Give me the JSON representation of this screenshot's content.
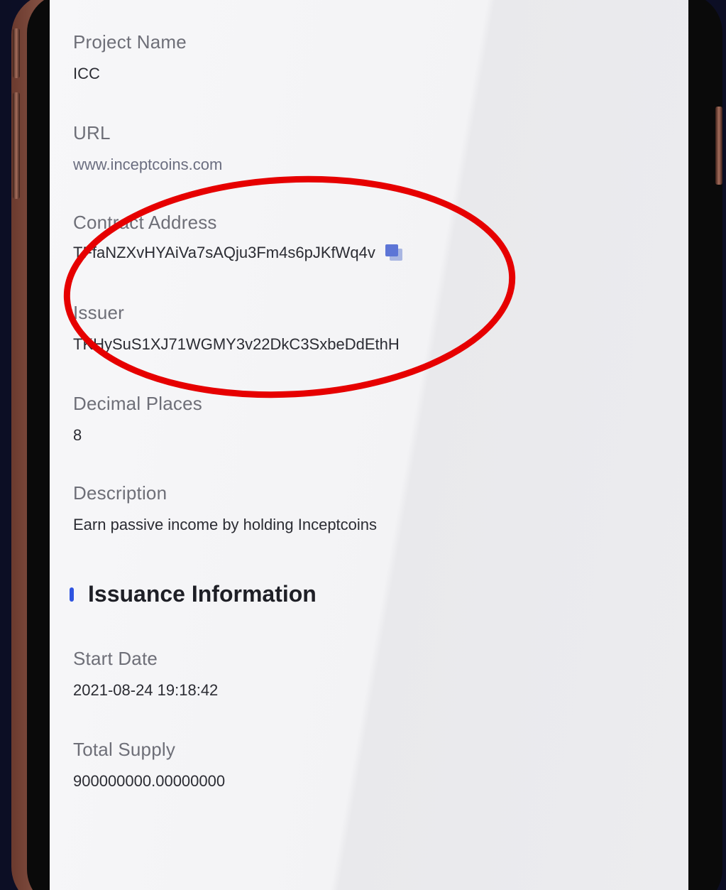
{
  "fields": {
    "project_name": {
      "label": "Project Name",
      "value": "ICC"
    },
    "url": {
      "label": "URL",
      "value": "www.inceptcoins.com"
    },
    "contract_address": {
      "label": "Contract Address",
      "value": "TFfaNZXvHYAiVa7sAQju3Fm4s6pJKfWq4v"
    },
    "issuer": {
      "label": "Issuer",
      "value": "TKHySuS1XJ71WGMY3v22DkC3SxbeDdEthH"
    },
    "decimal_places": {
      "label": "Decimal Places",
      "value": "8"
    },
    "description": {
      "label": "Description",
      "value": "Earn passive income by holding Inceptcoins"
    }
  },
  "issuance": {
    "title": "Issuance Information",
    "start_date": {
      "label": "Start Date",
      "value": "2021-08-24 19:18:42"
    },
    "total_supply": {
      "label": "Total Supply",
      "value": "900000000.00000000"
    }
  },
  "icons": {
    "copy": "copy-icon",
    "section_marker": "section-marker-icon"
  },
  "colors": {
    "accent": "#2f54e0",
    "annotation": "#e60000",
    "copy_icon": "#5d75d6"
  }
}
